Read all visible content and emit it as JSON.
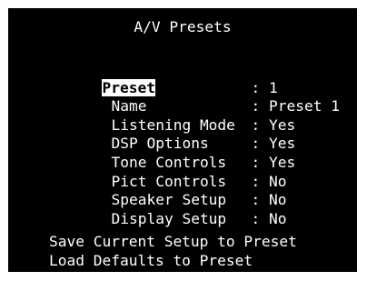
{
  "screen": {
    "title": "A/V Presets"
  },
  "menu": {
    "items": [
      {
        "label": "Preset",
        "value": "1",
        "selected": true
      },
      {
        "label": "Name",
        "value": "Preset 1"
      },
      {
        "label": "Listening Mode",
        "value": "Yes"
      },
      {
        "label": "DSP Options",
        "value": "Yes"
      },
      {
        "label": "Tone Controls",
        "value": "Yes"
      },
      {
        "label": "Pict Controls",
        "value": "No"
      },
      {
        "label": "Speaker Setup",
        "value": "No"
      },
      {
        "label": "Display Setup",
        "value": "No"
      }
    ],
    "separator": ":",
    "actions": [
      {
        "label": "Save Current Setup to Preset"
      },
      {
        "label": "Load Defaults to Preset"
      }
    ]
  }
}
